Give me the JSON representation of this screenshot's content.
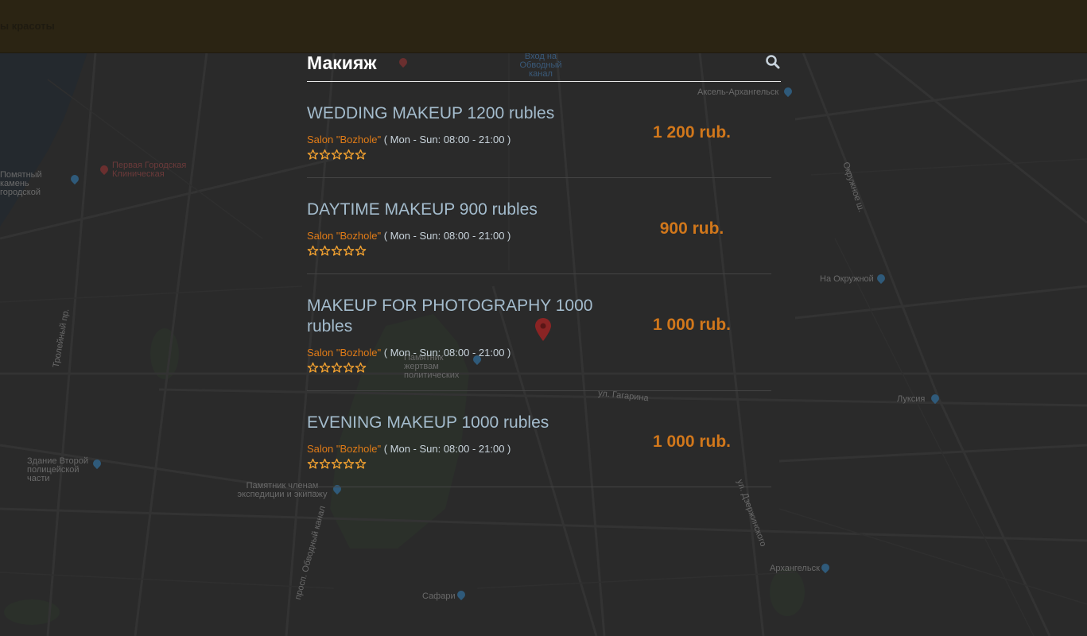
{
  "topbar": {
    "text": "ы красоты"
  },
  "search": {
    "value": "Макияж"
  },
  "results": [
    {
      "title": "WEDDING MAKEUP 1200 rubles",
      "salon": "Salon \"Bozhole\"",
      "hours": " ( Mon - Sun: 08:00 - 21:00 )",
      "price": "1 200 rub.",
      "rating": 5
    },
    {
      "title": "DAYTIME MAKEUP 900 rubles",
      "salon": "Salon \"Bozhole\"",
      "hours": " ( Mon - Sun: 08:00 - 21:00 )",
      "price": "900 rub.",
      "rating": 5
    },
    {
      "title": "MAKEUP FOR PHOTOGRAPHY 1000 rubles",
      "salon": "Salon \"Bozhole\"",
      "hours": " ( Mon - Sun: 08:00 - 21:00 )",
      "price": "1 000 rub.",
      "rating": 5
    },
    {
      "title": "EVENING MAKEUP 1000 rubles",
      "salon": "Salon \"Bozhole\"",
      "hours": " ( Mon - Sun: 08:00 - 21:00 )",
      "price": "1 000 rub.",
      "rating": 5
    }
  ],
  "map": {
    "labels": [
      "Помятный камень городской",
      "Первая Городская Клиническая",
      "Здание Второй полицейской части",
      "Памятник членам экспедиции и экипажу",
      "Памятник жертвам политических",
      "Аксель-Архангельск",
      "На Окружной",
      "Луксия",
      "Архангельск",
      "Сафари",
      "ул. Гагарина",
      "Окружное ш.",
      "Тролейный пр.",
      "просп. Обводный канал",
      "ул. Дзержинского",
      "Вход на Обводный канал"
    ]
  },
  "colors": {
    "accent": "#e07b17",
    "price": "#d1771b",
    "title": "#a4bccd",
    "star": "#f0a030"
  },
  "icons": {
    "search": "search-icon",
    "star": "star-icon",
    "map_pin": "map-pin-icon"
  }
}
